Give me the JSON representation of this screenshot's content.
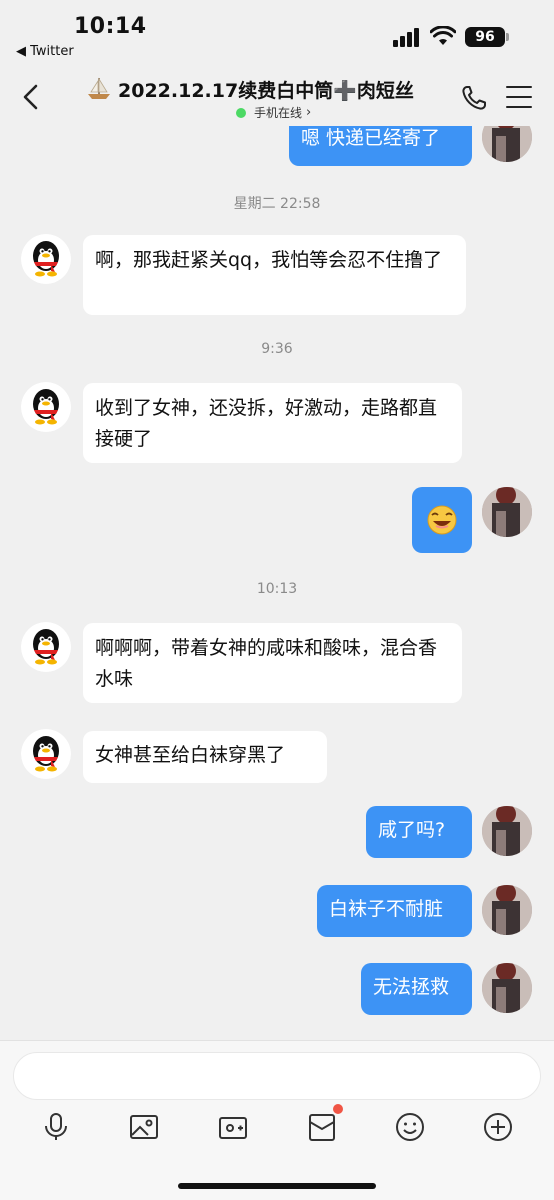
{
  "status_bar": {
    "time": "10:14",
    "back_app": "◀ Twitter",
    "battery": "96"
  },
  "header": {
    "title": "2022.12.17续费白中筒➕肉短丝",
    "subtitle": "手机在线",
    "subtitle_chevron": "›",
    "title_icon": "sailboat-icon"
  },
  "messages": [
    {
      "side": "out",
      "text": "嗯 快递已经寄了"
    },
    {
      "type": "timestamp",
      "text": "星期二 22:58"
    },
    {
      "side": "in",
      "text": "啊，那我赶紧关qq，我怕等会忍不住撸了"
    },
    {
      "type": "timestamp",
      "text": "9:36"
    },
    {
      "side": "in",
      "text": "收到了女神，还没拆，好激动，走路都直接硬了"
    },
    {
      "side": "out",
      "type": "emoji",
      "emoji": "laughing-face-emoji"
    },
    {
      "type": "timestamp",
      "text": "10:13"
    },
    {
      "side": "in",
      "text": "啊啊啊，带着女神的咸味和酸味，混合香水味"
    },
    {
      "side": "in",
      "text": "女神甚至给白袜穿黑了"
    },
    {
      "side": "out",
      "text": "咸了吗?"
    },
    {
      "side": "out",
      "text": "白袜子不耐脏"
    },
    {
      "side": "out",
      "text": "无法拯救"
    }
  ],
  "input": {
    "placeholder": ""
  },
  "toolbar": {
    "icons": [
      "microphone-icon",
      "image-icon",
      "camera-icon",
      "red-packet-icon",
      "emoji-icon",
      "plus-icon"
    ]
  },
  "colors": {
    "outgoing_bubble": "#3d93f5",
    "incoming_bubble": "#ffffff",
    "background": "#f0f0f0",
    "online_dot": "#4cd964",
    "badge": "#f05545"
  }
}
